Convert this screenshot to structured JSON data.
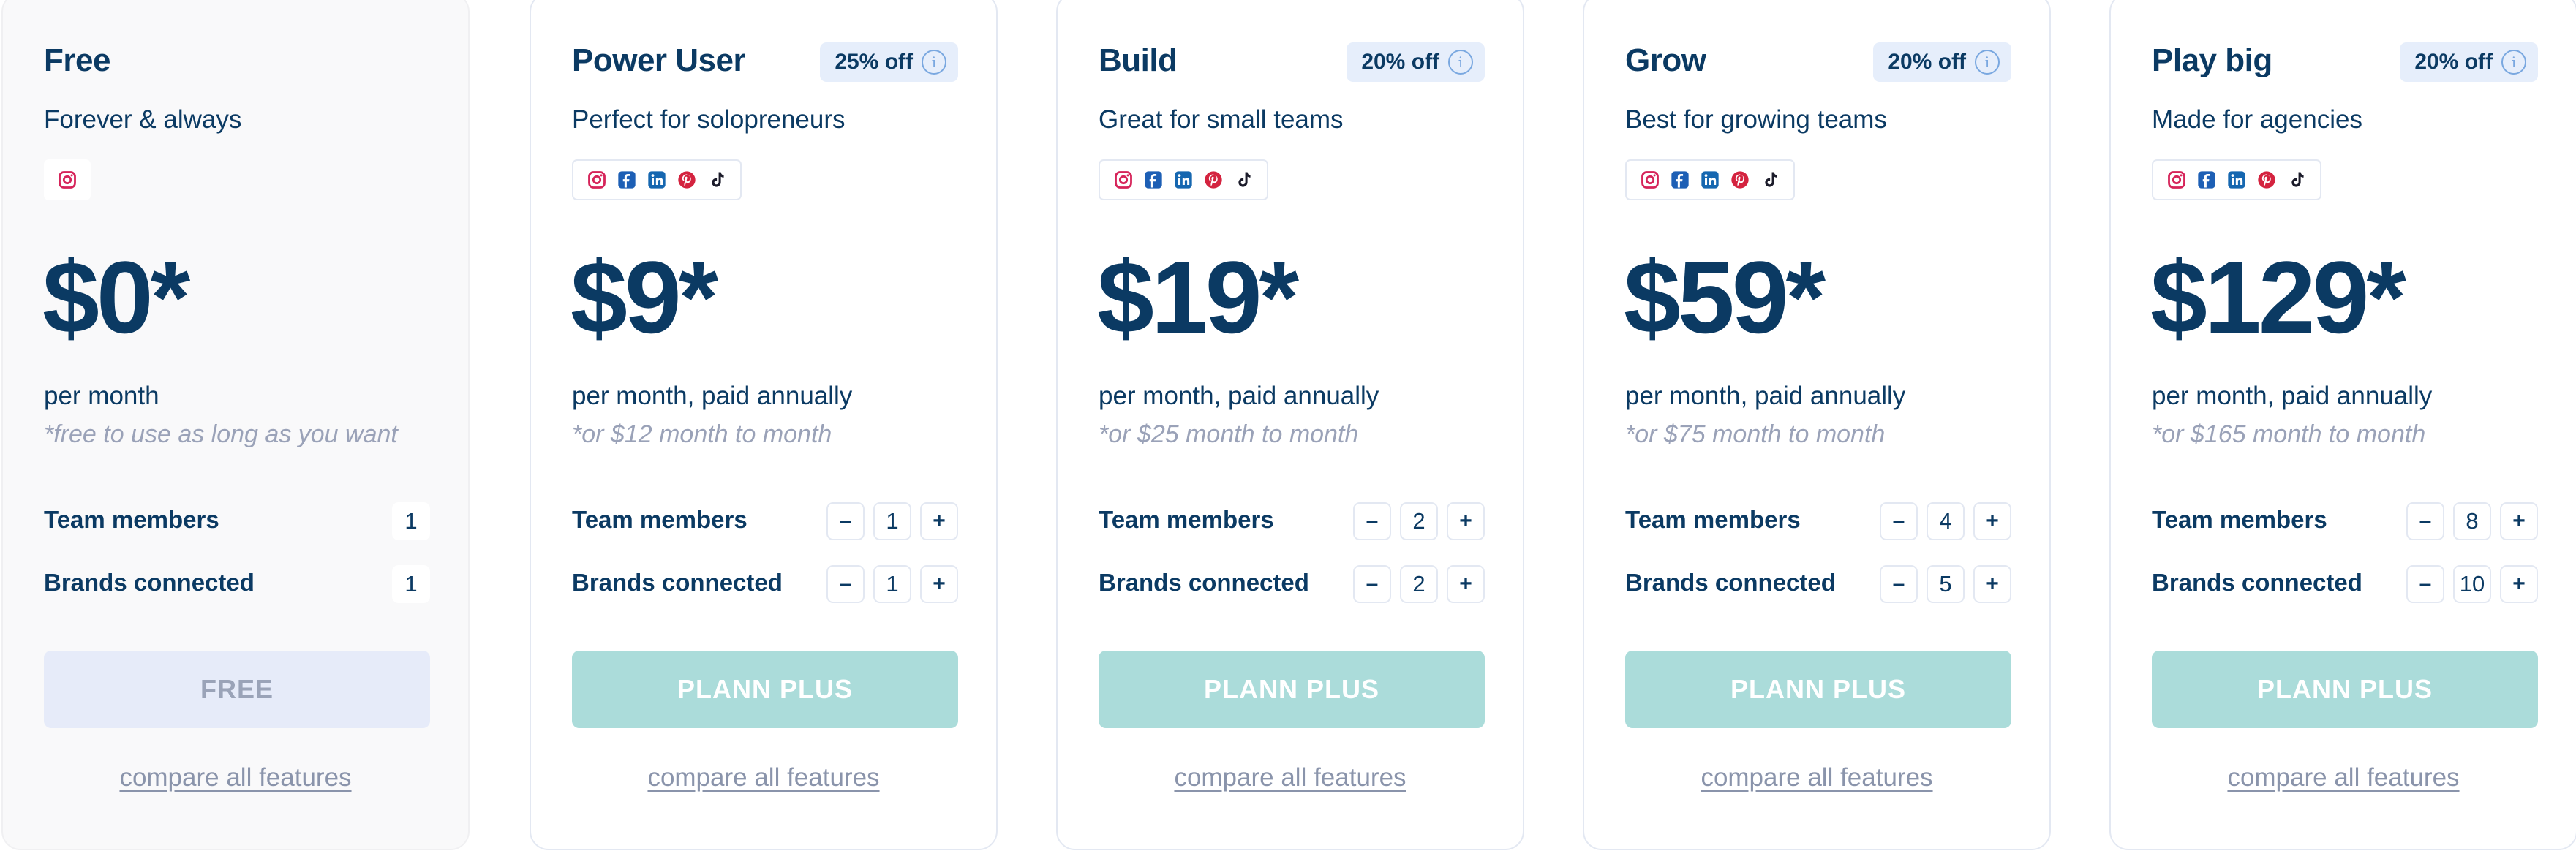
{
  "colors": {
    "primary_text": "#0b3a63",
    "muted_text": "#9aa2b8",
    "cta_bg": "#abdcda",
    "free_cta_bg": "#e6ebf9",
    "badge_bg": "#e6eefb"
  },
  "plans": [
    {
      "name": "Free",
      "badge": "",
      "subtitle": "Forever & always",
      "socials": [
        "instagram-icon"
      ],
      "price": "$0*",
      "period": "per month",
      "note": "*free to use as long as you want",
      "team_label": "Team members",
      "team_value": "1",
      "brands_label": "Brands connected",
      "brands_value": "1",
      "cta": "FREE",
      "compare": "compare all features"
    },
    {
      "name": "Power User",
      "badge": "25% off",
      "subtitle": "Perfect for solopreneurs",
      "socials": [
        "instagram-icon",
        "facebook-icon",
        "linkedin-icon",
        "pinterest-icon",
        "tiktok-icon"
      ],
      "price": "$9*",
      "period": "per month, paid annually",
      "note": "*or $12 month to month",
      "team_label": "Team members",
      "team_value": "1",
      "brands_label": "Brands connected",
      "brands_value": "1",
      "cta": "PLANN PLUS",
      "compare": "compare all features"
    },
    {
      "name": "Build",
      "badge": "20% off",
      "subtitle": "Great for small teams",
      "socials": [
        "instagram-icon",
        "facebook-icon",
        "linkedin-icon",
        "pinterest-icon",
        "tiktok-icon"
      ],
      "price": "$19*",
      "period": "per month, paid annually",
      "note": "*or $25 month to month",
      "team_label": "Team members",
      "team_value": "2",
      "brands_label": "Brands connected",
      "brands_value": "2",
      "cta": "PLANN PLUS",
      "compare": "compare all features"
    },
    {
      "name": "Grow",
      "badge": "20% off",
      "subtitle": "Best for growing teams",
      "socials": [
        "instagram-icon",
        "facebook-icon",
        "linkedin-icon",
        "pinterest-icon",
        "tiktok-icon"
      ],
      "price": "$59*",
      "period": "per month, paid annually",
      "note": "*or $75 month to month",
      "team_label": "Team members",
      "team_value": "4",
      "brands_label": "Brands connected",
      "brands_value": "5",
      "cta": "PLANN PLUS",
      "compare": "compare all features"
    },
    {
      "name": "Play big",
      "badge": "20% off",
      "subtitle": "Made for agencies",
      "socials": [
        "instagram-icon",
        "facebook-icon",
        "linkedin-icon",
        "pinterest-icon",
        "tiktok-icon"
      ],
      "price": "$129*",
      "period": "per month, paid annually",
      "note": "*or $165 month to month",
      "team_label": "Team members",
      "team_value": "8",
      "brands_label": "Brands connected",
      "brands_value": "10",
      "cta": "PLANN PLUS",
      "compare": "compare all features"
    }
  ],
  "stepper": {
    "minus": "–",
    "plus": "+"
  },
  "info_glyph": "i"
}
